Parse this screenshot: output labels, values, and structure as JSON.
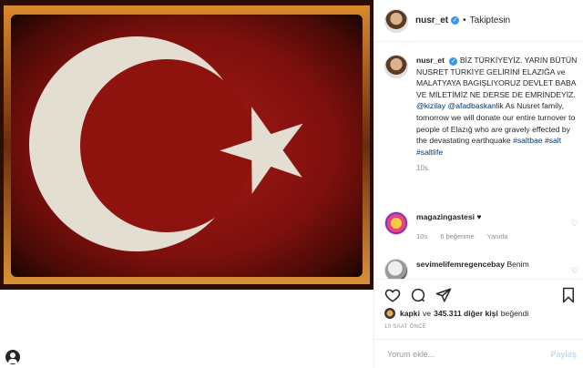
{
  "post": {
    "username": "nusr_et",
    "follow_label": "Takiptesin",
    "caption_user": "nusr_et",
    "caption_tr": "BİZ TÜRKİYEYİZ. YARIN BÜTÜN NUSRET TÜRKİYE GELİRİNİ ELAZIĞA ve MALATYAYA BAGIŞLIYORUZ DEVLET BABA VE MİLETİMİZ NE DERSE DE EMRİNDEYİZ.",
    "caption_mentions": "@kizilay @afadbaskanlik",
    "caption_en": "As Nusret family, tomorrow we will donate our entire turnover to people of Elazığ who are gravely effected by the devastating earthquake",
    "caption_tags": "#saltbae #salt #saltlife",
    "caption_time": "10s"
  },
  "comments": [
    {
      "user": "magazingastesi",
      "text": "♥",
      "time": "10s",
      "likes": "6 beğenme",
      "reply": "Yanıtla"
    },
    {
      "user": "sevimelifemregencebay",
      "text": "Benim"
    }
  ],
  "likes": {
    "user": "kapki",
    "middle": "ve",
    "count": "345.311 diğer kişi",
    "suffix": "beğendi"
  },
  "time_ago": "10 SAAT ÖNCE",
  "comment_input": {
    "placeholder": "Yorum ekle..."
  },
  "post_button": "Paylaş",
  "icons": [
    "verified-badge",
    "heart-icon",
    "comment-icon",
    "share-icon",
    "bookmark-icon",
    "user-icon"
  ]
}
